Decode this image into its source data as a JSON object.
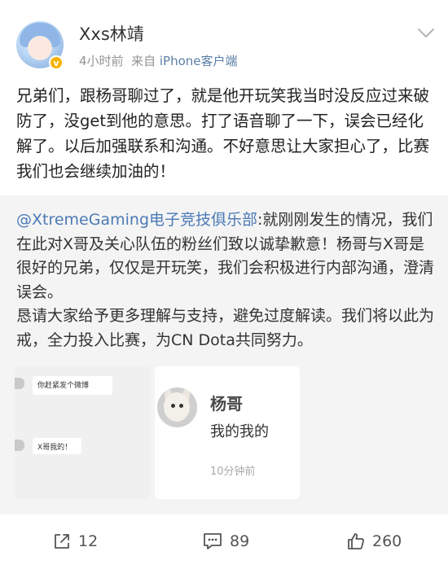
{
  "post": {
    "username": "Xxs林靖",
    "time": "4小时前",
    "source_prefix": "来自",
    "source": "iPhone客户端",
    "text": "兄弟们，跟杨哥聊过了，就是他开玩笑我当时没反应过来破防了，没get到他的意思。打了语音聊了一下，误会已经化解了。以后加强联系和沟通。不好意思让大家担心了，比赛我们也会继续加油的！"
  },
  "repost": {
    "mention": "@XtremeGaming电子竞技俱乐部",
    "text": ":就刚刚发生的情况，我们在此对X哥及关心队伍的粉丝们致以诚挚歉意！杨哥与X哥是很好的兄弟，仅仅是开玩笑，我们会积极进行内部沟通，澄清误会。",
    "text2": "恳请大家给予更多理解与支持，避免过度解读。我们将以此为戒，全力投入比赛，为CN Dota共同努力。",
    "images": {
      "chat": {
        "msg1": "你赶紧发个微博",
        "msg2": "X哥我的！"
      },
      "contact": {
        "name": "杨哥",
        "message": "我的我的",
        "time": "10分钟前"
      }
    }
  },
  "actions": {
    "share_count": "12",
    "comment_count": "89",
    "like_count": "260"
  },
  "icons": {
    "share": "share-icon",
    "comment": "comment-icon",
    "like": "thumbs-up-icon",
    "more": "chevron-down-icon",
    "verified": "verified-badge-icon"
  },
  "colors": {
    "link": "#4b7ab6",
    "meta": "#939393",
    "badge": "#f6b400",
    "repost_bg": "#f4f4f4"
  }
}
